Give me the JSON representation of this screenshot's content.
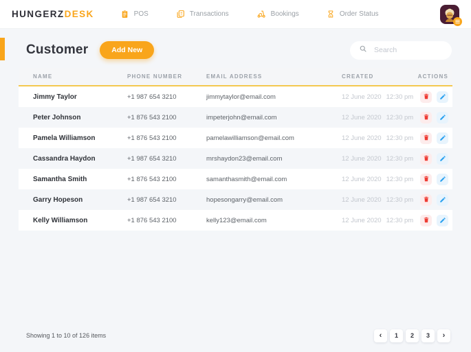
{
  "brand": {
    "name_primary": "HUNGERZ",
    "name_secondary": "DESK"
  },
  "nav": {
    "items": [
      {
        "label": "POS",
        "icon": "pos-clipboard-icon"
      },
      {
        "label": "Transactions",
        "icon": "transactions-pages-icon"
      },
      {
        "label": "Bookings",
        "icon": "bookings-scooter-icon"
      },
      {
        "label": "Order Status",
        "icon": "order-status-hourglass-icon"
      }
    ]
  },
  "page": {
    "title": "Customer",
    "add_button_label": "Add New"
  },
  "search": {
    "placeholder": "Search",
    "icon": "search-icon"
  },
  "table": {
    "headers": [
      "NAME",
      "PHONE NUMBER",
      "EMAIL ADDRESS",
      "CREATED",
      "ACTIONS"
    ],
    "rows": [
      {
        "name": "Jimmy Taylor",
        "phone": "+1 987 654 3210",
        "email": "jimmytaylor@email.com",
        "created_date": "12 June 2020",
        "created_time": "12:30 pm"
      },
      {
        "name": "Peter Johnson",
        "phone": "+1 876 543 2100",
        "email": "impeterjohn@email.com",
        "created_date": "12 June 2020",
        "created_time": "12:30 pm"
      },
      {
        "name": "Pamela Williamson",
        "phone": "+1 876 543 2100",
        "email": "pamelawilliamson@email.com",
        "created_date": "12 June 2020",
        "created_time": "12:30 pm"
      },
      {
        "name": "Cassandra Haydon",
        "phone": "+1 987 654 3210",
        "email": "mrshaydon23@email.com",
        "created_date": "12 June 2020",
        "created_time": "12:30 pm"
      },
      {
        "name": "Samantha Smith",
        "phone": "+1 876 543 2100",
        "email": "samanthasmith@email.com",
        "created_date": "12 June 2020",
        "created_time": "12:30 pm"
      },
      {
        "name": "Garry Hopeson",
        "phone": "+1 987 654 3210",
        "email": "hopesongarry@email.com",
        "created_date": "12 June 2020",
        "created_time": "12:30 pm"
      },
      {
        "name": "Kelly Williamson",
        "phone": "+1 876 543 2100",
        "email": "kelly123@email.com",
        "created_date": "12 June 2020",
        "created_time": "12:30 pm"
      }
    ],
    "row_action_icons": [
      "trash-icon",
      "pencil-icon"
    ]
  },
  "footer": {
    "summary": "Showing 1 to 10 of 126 items"
  },
  "pagination": {
    "prev_label": "‹",
    "next_label": "›",
    "pages": [
      "1",
      "2",
      "3"
    ]
  },
  "colors": {
    "accent_orange": "#f9a51b",
    "header_underline_gold": "#f3c84f",
    "delete_red": "#ee3b33",
    "edit_blue": "#2aa1f0",
    "page_background": "#f4f6f9",
    "muted_text": "#9aa0a6",
    "created_text": "#c3c7ce"
  }
}
